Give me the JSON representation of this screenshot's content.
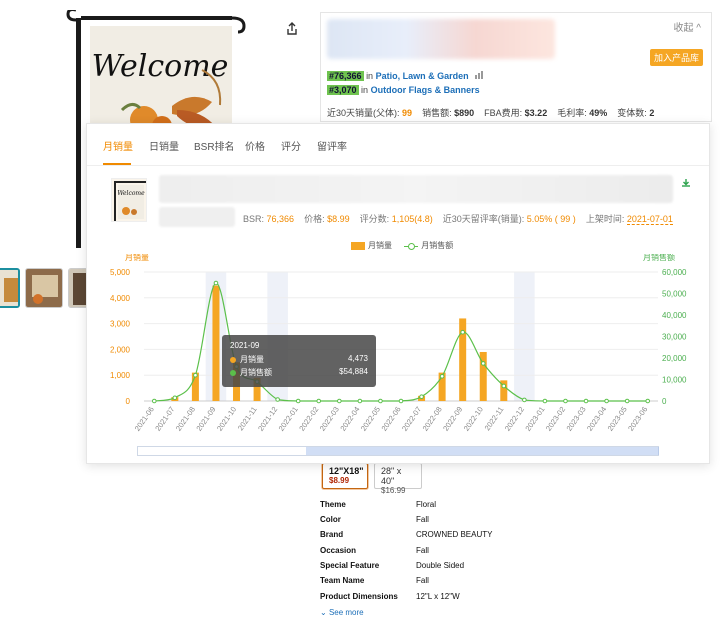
{
  "product": {
    "image_text": "Welcome"
  },
  "info_panel": {
    "collapse_label": "收起 ^",
    "add_to_library_label": "加入产品库",
    "rank1_badge": "#76,366",
    "rank1_in": "in",
    "rank1_category": "Patio, Lawn & Garden",
    "rank2_badge": "#3,070",
    "rank2_in": "in",
    "rank2_category": "Outdoor Flags & Banners",
    "stats": [
      {
        "label": "近30天销量(父体):",
        "value": "99"
      },
      {
        "label": "销售额:",
        "value": "$890"
      },
      {
        "label": "FBA费用:",
        "value": "$3.22"
      },
      {
        "label": "毛利率:",
        "value": "49%"
      },
      {
        "label": "变体数:",
        "value": "2"
      }
    ]
  },
  "popup": {
    "tabs": [
      "月销量",
      "日销量",
      "BSR排名",
      "价格",
      "评分",
      "留评率"
    ],
    "active_tab": 0,
    "meta": {
      "bsr_label": "BSR:",
      "bsr_value": "76,366",
      "price_label": "价格:",
      "price_value": "$8.99",
      "rating_label": "评分数:",
      "rating_value": "1,105(4.8)",
      "review_label": "近30天留评率(销量):",
      "review_value": "5.05% ( 99 )",
      "launch_label": "上架时间:",
      "launch_value": "2021-07-01"
    },
    "mini_image_text": "Welcome",
    "legend_bar": "月销量",
    "legend_line": "月销售额",
    "tooltip": {
      "title": "2021-09",
      "row1_label": "月销量",
      "row1_value": "4,473",
      "row2_label": "月销售额",
      "row2_value": "$54,884"
    }
  },
  "chart_data": {
    "type": "bar",
    "title": "",
    "left_axis_label": "月销量",
    "right_axis_label": "月销售额",
    "categories": [
      "2021-06",
      "2021-07",
      "2021-08",
      "2021-09",
      "2021-10",
      "2021-11",
      "2021-12",
      "2022-01",
      "2022-02",
      "2022-03",
      "2022-04",
      "2022-05",
      "2022-06",
      "2022-07",
      "2022-08",
      "2022-09",
      "2022-10",
      "2022-11",
      "2022-12",
      "2023-01",
      "2023-02",
      "2023-03",
      "2023-04",
      "2023-05",
      "2023-06"
    ],
    "series": [
      {
        "name": "月销量",
        "type": "bar",
        "axis": "left",
        "values": [
          0,
          150,
          1100,
          4473,
          1500,
          900,
          0,
          0,
          0,
          0,
          0,
          0,
          0,
          200,
          1100,
          3200,
          1900,
          800,
          0,
          0,
          0,
          0,
          0,
          0,
          0
        ]
      },
      {
        "name": "月销售额",
        "type": "line",
        "axis": "right",
        "values": [
          0,
          1500,
          12000,
          54884,
          16000,
          9000,
          700,
          0,
          0,
          0,
          0,
          0,
          0,
          2000,
          11500,
          32000,
          17500,
          7000,
          500,
          0,
          0,
          0,
          0,
          0,
          0
        ]
      }
    ],
    "left_ticks": [
      "0",
      "1,000",
      "2,000",
      "3,000",
      "4,000",
      "5,000"
    ],
    "right_ticks": [
      "0",
      "10,000",
      "20,000",
      "30,000",
      "40,000",
      "50,000",
      "60,000"
    ],
    "ylim_left": [
      0,
      5000
    ],
    "ylim_right": [
      0,
      60000
    ],
    "highlight_bands": [
      "2021-09",
      "2021-12",
      "2022-12"
    ],
    "grid": true,
    "legend_position": "top-center",
    "colors": {
      "bar": "#f5a623",
      "line": "#5bc04a",
      "left_axis": "#f08a00",
      "right_axis": "#4caf50"
    }
  },
  "variants": [
    {
      "size": "12\"X18\"",
      "price": "$8.99",
      "selected": true
    },
    {
      "size": "28\" x 40\"",
      "price": "$16.99",
      "selected": false
    }
  ],
  "specs": [
    {
      "key": "Theme",
      "value": "Floral"
    },
    {
      "key": "Color",
      "value": "Fall"
    },
    {
      "key": "Brand",
      "value": "CROWNED BEAUTY"
    },
    {
      "key": "Occasion",
      "value": "Fall"
    },
    {
      "key": "Special Feature",
      "value": "Double Sided"
    },
    {
      "key": "Team Name",
      "value": "Fall"
    },
    {
      "key": "Product Dimensions",
      "value": "12\"L x 12\"W"
    }
  ],
  "see_more_label": "See more"
}
